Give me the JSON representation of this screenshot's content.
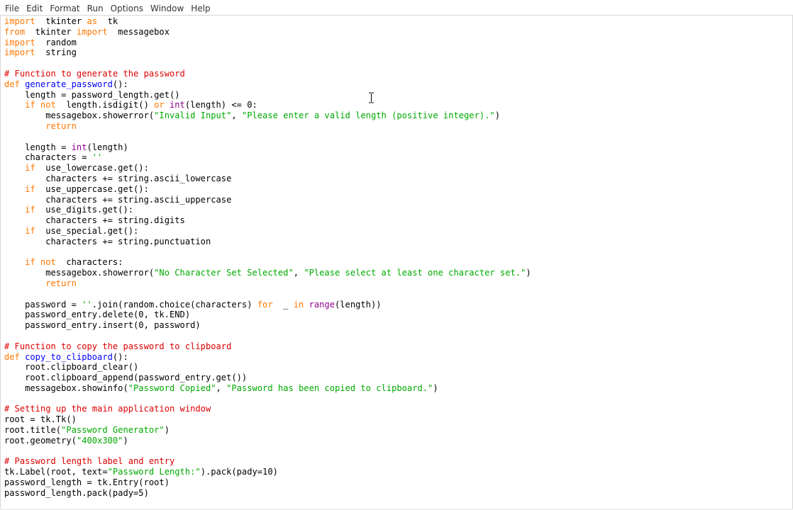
{
  "menu": [
    "File",
    "Edit",
    "Format",
    "Run",
    "Options",
    "Window",
    "Help"
  ],
  "cursor": "i-beam-cursor",
  "colors": {
    "keyword": "#ff7700",
    "builtin": "#900090",
    "string": "#00aa00",
    "comment": "#dd0000",
    "definition": "#0000ff",
    "text": "#000000"
  },
  "code_lines": [
    [
      [
        "kw",
        "import"
      ],
      [
        "",
        "  tkinter "
      ],
      [
        "kw",
        "as"
      ],
      [
        "",
        "  tk"
      ]
    ],
    [
      [
        "kw",
        "from"
      ],
      [
        "",
        "  tkinter "
      ],
      [
        "kw",
        "import"
      ],
      [
        "",
        "  messagebox"
      ]
    ],
    [
      [
        "kw",
        "import"
      ],
      [
        "",
        "  random"
      ]
    ],
    [
      [
        "kw",
        "import"
      ],
      [
        "",
        "  string"
      ]
    ],
    [
      [
        "",
        ""
      ]
    ],
    [
      [
        "cm",
        "# Function to generate the password"
      ]
    ],
    [
      [
        "kw",
        "def"
      ],
      [
        "",
        " "
      ],
      [
        "df",
        "generate_password"
      ],
      [
        "",
        "():"
      ]
    ],
    [
      [
        "",
        "    length = password_length.get()"
      ]
    ],
    [
      [
        "",
        "    "
      ],
      [
        "kw",
        "if not"
      ],
      [
        "",
        "  length.isdigit() "
      ],
      [
        "kw",
        "or"
      ],
      [
        "",
        " "
      ],
      [
        "bi",
        "int"
      ],
      [
        "",
        "(length) <= 0:"
      ]
    ],
    [
      [
        "",
        "        messagebox.showerror("
      ],
      [
        "st",
        "\"Invalid Input\""
      ],
      [
        "",
        ", "
      ],
      [
        "st",
        "\"Please enter a valid length (positive integer).\""
      ],
      [
        "",
        ")"
      ]
    ],
    [
      [
        "",
        "        "
      ],
      [
        "kw",
        "return"
      ]
    ],
    [
      [
        "",
        ""
      ]
    ],
    [
      [
        "",
        "    length = "
      ],
      [
        "bi",
        "int"
      ],
      [
        "",
        "(length)"
      ]
    ],
    [
      [
        "",
        "    characters = "
      ],
      [
        "st",
        "''"
      ]
    ],
    [
      [
        "",
        "    "
      ],
      [
        "kw",
        "if"
      ],
      [
        "",
        "  use_lowercase.get():"
      ]
    ],
    [
      [
        "",
        "        characters += string.ascii_lowercase"
      ]
    ],
    [
      [
        "",
        "    "
      ],
      [
        "kw",
        "if"
      ],
      [
        "",
        "  use_uppercase.get():"
      ]
    ],
    [
      [
        "",
        "        characters += string.ascii_uppercase"
      ]
    ],
    [
      [
        "",
        "    "
      ],
      [
        "kw",
        "if"
      ],
      [
        "",
        "  use_digits.get():"
      ]
    ],
    [
      [
        "",
        "        characters += string.digits"
      ]
    ],
    [
      [
        "",
        "    "
      ],
      [
        "kw",
        "if"
      ],
      [
        "",
        "  use_special.get():"
      ]
    ],
    [
      [
        "",
        "        characters += string.punctuation"
      ]
    ],
    [
      [
        "",
        ""
      ]
    ],
    [
      [
        "",
        "    "
      ],
      [
        "kw",
        "if not"
      ],
      [
        "",
        "  characters:"
      ]
    ],
    [
      [
        "",
        "        messagebox.showerror("
      ],
      [
        "st",
        "\"No Character Set Selected\""
      ],
      [
        "",
        ", "
      ],
      [
        "st",
        "\"Please select at least one character set.\""
      ],
      [
        "",
        ")"
      ]
    ],
    [
      [
        "",
        "        "
      ],
      [
        "kw",
        "return"
      ]
    ],
    [
      [
        "",
        ""
      ]
    ],
    [
      [
        "",
        "    password = "
      ],
      [
        "st",
        "''"
      ],
      [
        "",
        ".join(random.choice(characters) "
      ],
      [
        "kw",
        "for"
      ],
      [
        "",
        "  _ "
      ],
      [
        "kw",
        "in"
      ],
      [
        "",
        " "
      ],
      [
        "bi",
        "range"
      ],
      [
        "",
        "(length))"
      ]
    ],
    [
      [
        "",
        "    password_entry.delete(0, tk.END)"
      ]
    ],
    [
      [
        "",
        "    password_entry.insert(0, password)"
      ]
    ],
    [
      [
        "",
        ""
      ]
    ],
    [
      [
        "cm",
        "# Function to copy the password to clipboard"
      ]
    ],
    [
      [
        "kw",
        "def"
      ],
      [
        "",
        " "
      ],
      [
        "df",
        "copy_to_clipboard"
      ],
      [
        "",
        "():"
      ]
    ],
    [
      [
        "",
        "    root.clipboard_clear()"
      ]
    ],
    [
      [
        "",
        "    root.clipboard_append(password_entry.get())"
      ]
    ],
    [
      [
        "",
        "    messagebox.showinfo("
      ],
      [
        "st",
        "\"Password Copied\""
      ],
      [
        "",
        ", "
      ],
      [
        "st",
        "\"Password has been copied to clipboard.\""
      ],
      [
        "",
        ")"
      ]
    ],
    [
      [
        "",
        ""
      ]
    ],
    [
      [
        "cm",
        "# Setting up the main application window"
      ]
    ],
    [
      [
        "",
        "root = tk.Tk()"
      ]
    ],
    [
      [
        "",
        "root.title("
      ],
      [
        "st",
        "\"Password Generator\""
      ],
      [
        "",
        ")"
      ]
    ],
    [
      [
        "",
        "root.geometry("
      ],
      [
        "st",
        "\"400x300\""
      ],
      [
        "",
        ")"
      ]
    ],
    [
      [
        "",
        ""
      ]
    ],
    [
      [
        "cm",
        "# Password length label and entry"
      ]
    ],
    [
      [
        "",
        "tk.Label(root, text="
      ],
      [
        "st",
        "\"Password Length:\""
      ],
      [
        "",
        ").pack(pady=10)"
      ]
    ],
    [
      [
        "",
        "password_length = tk.Entry(root)"
      ]
    ],
    [
      [
        "",
        "password_length.pack(pady=5)"
      ]
    ]
  ]
}
